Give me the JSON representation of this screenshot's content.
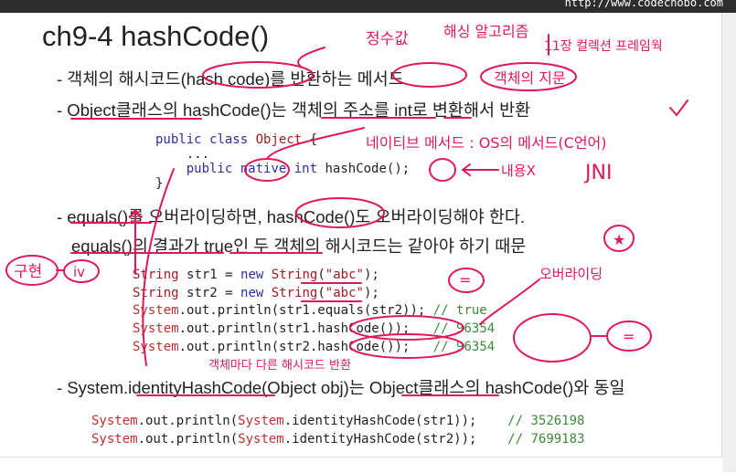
{
  "url": "http://www.codechobo.com",
  "title": "ch9-4 hashCode()",
  "bullets": [
    "- 객체의 해시코드(hash code)를 반환하는 메서드",
    "- Object클래스의 hashCode()는 객체의 주소를 int로 변환해서 반환",
    "- equals()를 오버라이딩하면, hashCode()도 오버라이딩해야 한다.",
    "equals()의 결과가 true인 두 객체의 해시코드는 같아야 하기 때문",
    "- System.identityHashCode(Object obj)는 Object클래스의 hashCode()와 동일"
  ],
  "code1": {
    "line1": [
      "public",
      "class",
      "Object",
      "{"
    ],
    "line2": "...",
    "line3": [
      "public",
      "native",
      "int",
      "hashCode();"
    ],
    "line4": "}"
  },
  "code2": {
    "str1_decl": [
      "String",
      "str1",
      "=",
      "new",
      "String",
      "(",
      "\"abc\"",
      ");"
    ],
    "str2_decl": [
      "String",
      "str2",
      "=",
      "new",
      "String",
      "(",
      "\"abc\"",
      ");"
    ],
    "println1": [
      "System",
      ".out.println(str1.equals(str2));",
      "// true"
    ],
    "println2": [
      "System",
      ".out.println(str1.hashCode());",
      "// 96354"
    ],
    "println3": [
      "System",
      ".out.println(str2.hashCode());",
      "// 96354"
    ]
  },
  "code3": {
    "line1": [
      "System",
      ".out.println(",
      "System",
      ".identityHashCode(str1));",
      "// 3526198"
    ],
    "line2": [
      "System",
      ".out.println(",
      "System",
      ".identityHashCode(str2));",
      "// 7699183"
    ]
  },
  "annotations": {
    "a1": "정수값",
    "a2": "해싱 알고리즘",
    "a3": "11장 컬렉션 프레임웍",
    "a4": "객체의 지문",
    "a5": "네이티브 메서드 : OS의 메서드(C언어)",
    "a6": "JNI",
    "a7": "내용X",
    "a8": "오버라이딩",
    "a9": "객체마다 다른 해시코드 반환",
    "a10": "구현",
    "a11": "iv"
  },
  "colors": {
    "ink": "#e0185a",
    "keyword": "#2e2ea0",
    "class": "#a01c1c",
    "comment": "#3a8a3a"
  }
}
